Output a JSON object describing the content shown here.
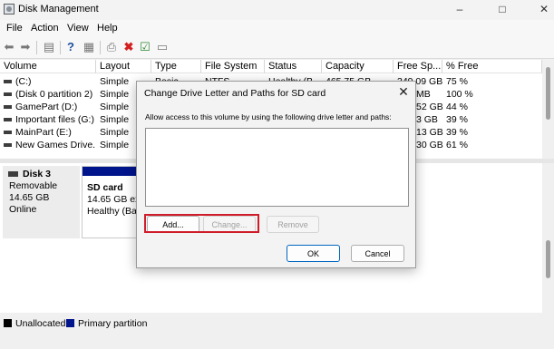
{
  "window": {
    "title": "Disk Management"
  },
  "menu": [
    "File",
    "Action",
    "View",
    "Help"
  ],
  "toolbar": {
    "icons": [
      "back-arrow-icon",
      "forward-arrow-icon",
      "disk-list-icon",
      "help-icon",
      "properties-icon",
      "connect-drive-icon",
      "delete-icon",
      "check-icon",
      "view-icon"
    ]
  },
  "volume_table": {
    "columns": [
      "Volume",
      "Layout",
      "Type",
      "File System",
      "Status",
      "Capacity",
      "Free Sp...",
      "% Free"
    ],
    "rows": [
      {
        "volume": "(C:)",
        "layout": "Simple",
        "type": "Basic",
        "fs": "NTFS",
        "status": "Healthy (B...",
        "capacity": "465.75 GB",
        "free": "349.09 GB",
        "pct": "75 %"
      },
      {
        "volume": "(Disk 0 partition 2)",
        "layout": "Simple",
        "type": "",
        "fs": "",
        "status": "",
        "capacity": "",
        "free": "MB",
        "pct": "100 %"
      },
      {
        "volume": "GamePart (D:)",
        "layout": "Simple",
        "type": "",
        "fs": "",
        "status": "",
        "capacity": "",
        "free": "52 GB",
        "pct": "44 %"
      },
      {
        "volume": "Important files (G:)",
        "layout": "Simple",
        "type": "",
        "fs": "",
        "status": "",
        "capacity": "",
        "free": "3 GB",
        "pct": "39 %"
      },
      {
        "volume": "MainPart (E:)",
        "layout": "Simple",
        "type": "",
        "fs": "",
        "status": "",
        "capacity": "",
        "free": "13 GB",
        "pct": "39 %"
      },
      {
        "volume": "New Games Drive...",
        "layout": "Simple",
        "type": "",
        "fs": "",
        "status": "",
        "capacity": "",
        "free": "30 GB",
        "pct": "61 %"
      }
    ]
  },
  "disk": {
    "name": "Disk 3",
    "kind": "Removable",
    "size": "14.65 GB",
    "state": "Online",
    "partition": {
      "name": "SD card",
      "size": "14.65 GB exF",
      "status": "Healthy (Bas"
    }
  },
  "legend": [
    {
      "label": "Unallocated",
      "color": "#000000"
    },
    {
      "label": "Primary partition",
      "color": "#00148c"
    }
  ],
  "dialog": {
    "title": "Change Drive Letter and Paths for SD card",
    "description": "Allow access to this volume by using the following drive letter and paths:",
    "add_label": "Add...",
    "change_label": "Change...",
    "remove_label": "Remove",
    "ok_label": "OK",
    "cancel_label": "Cancel"
  },
  "colors": {
    "highlight": "#d01c2a",
    "primary_partition": "#00148c"
  }
}
